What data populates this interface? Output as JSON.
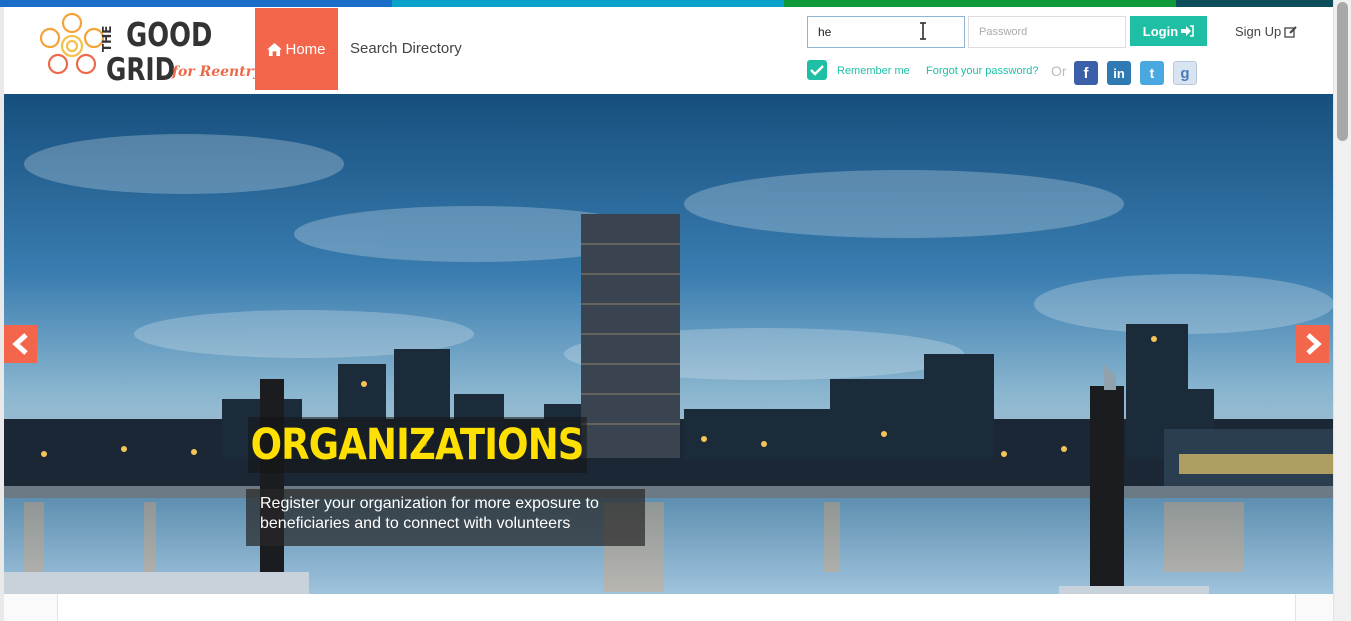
{
  "brand": {
    "logo_line1": "THE",
    "logo_line2": "GOOD",
    "logo_line3": "GRID",
    "logo_tagline": "for Reentry",
    "colors": [
      "#1a6ec7",
      "#0aa2c9",
      "#0f9a3a",
      "#0e4e5c"
    ]
  },
  "nav": {
    "home_label": "Home",
    "home_icon": "home-icon",
    "search_label": "Search Directory"
  },
  "login": {
    "username_value": "he",
    "password_placeholder": "Password",
    "login_label": "Login",
    "login_icon": "sign-in-icon",
    "signup_label": "Sign Up",
    "signup_icon": "edit-icon",
    "remember_label": "Remember me",
    "remember_checked": true,
    "forgot_label": "Forgot your password?",
    "or_label": "Or",
    "social": [
      "facebook-icon",
      "linkedin-icon",
      "twitter-icon",
      "google-icon"
    ],
    "accent": "#1fbfa6"
  },
  "hero": {
    "title": "ORGANIZATIONS",
    "description": "Register your organization for more exposure to beneficiaries and to connect with volunteers",
    "accent": "#f4664b",
    "title_color": "#ffe000"
  }
}
